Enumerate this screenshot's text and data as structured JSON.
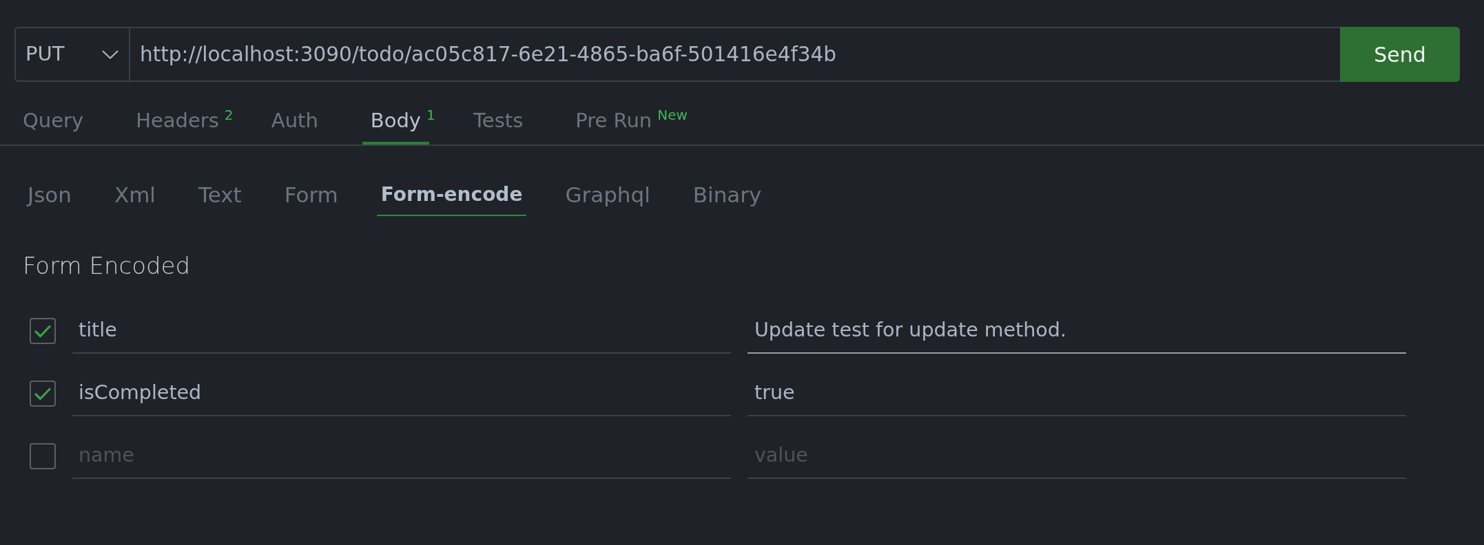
{
  "request": {
    "method": "PUT",
    "url": "http://localhost:3090/todo/ac05c817-6e21-4865-ba6f-501416e4f34b",
    "send": "Send"
  },
  "tabs": [
    {
      "label": "Query",
      "selected": false
    },
    {
      "label": "Headers",
      "badge": "2",
      "selected": false
    },
    {
      "label": "Auth",
      "selected": false
    },
    {
      "label": "Body",
      "badge": "1",
      "selected": true
    },
    {
      "label": "Tests",
      "selected": false
    },
    {
      "label": "Pre Run",
      "badge": "New",
      "selected": false
    }
  ],
  "body_tabs": [
    {
      "label": "Json",
      "selected": false
    },
    {
      "label": "Xml",
      "selected": false
    },
    {
      "label": "Text",
      "selected": false
    },
    {
      "label": "Form",
      "selected": false
    },
    {
      "label": "Form-encode",
      "selected": true
    },
    {
      "label": "Graphql",
      "selected": false
    },
    {
      "label": "Binary",
      "selected": false
    }
  ],
  "form": {
    "title": "Form Encoded",
    "rows": [
      {
        "checked": true,
        "key": {
          "value": "title",
          "focused": false
        },
        "value": {
          "value": "Update test for update method.",
          "focused": true
        }
      },
      {
        "checked": true,
        "key": {
          "value": "isCompleted",
          "focused": false
        },
        "value": {
          "value": "true",
          "focused": false
        }
      },
      {
        "checked": false,
        "key": {
          "placeholder": "name",
          "focused": false
        },
        "value": {
          "placeholder": "value",
          "focused": false
        }
      }
    ]
  }
}
